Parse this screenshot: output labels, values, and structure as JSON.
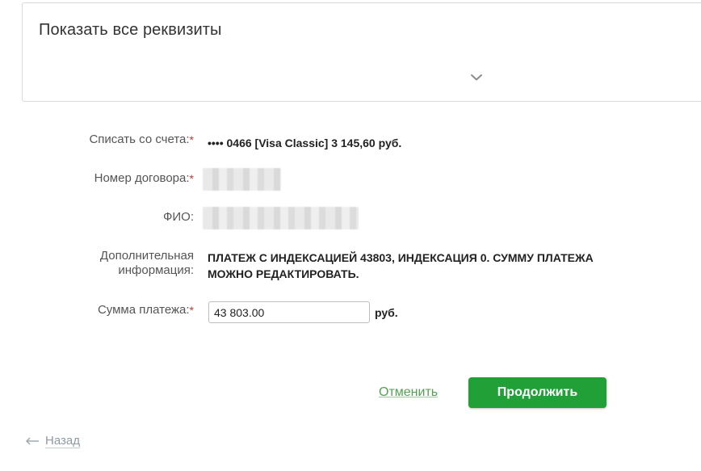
{
  "details": {
    "title": "Показать все реквизиты",
    "toggle_icon": "chevron-down-icon"
  },
  "form": {
    "account": {
      "label": "Списать со счета:",
      "required_mark": "*",
      "value": "•••• 0466  [Visa Classic] 3 145,60   руб."
    },
    "contract": {
      "label": "Номер договора:",
      "required_mark": "*"
    },
    "fio": {
      "label": "ФИО:"
    },
    "additional_info": {
      "label_line1": "Дополнительная",
      "label_line2": "информация:",
      "value_line1": "ПЛАТЕЖ С ИНДЕКСАЦИЕЙ 43803, ИНДЕКСАЦИЯ 0. СУММУ ПЛАТЕЖА",
      "value_line2": "МОЖНО РЕДАКТИРОВАТЬ."
    },
    "amount": {
      "label": "Сумма платежа:",
      "required_mark": "*",
      "value": "43 803.00",
      "currency": "руб."
    }
  },
  "actions": {
    "cancel_label": "Отменить",
    "continue_label": "Продолжить"
  },
  "navigation": {
    "back_label": "Назад",
    "back_icon": "arrow-left-icon"
  },
  "colors": {
    "primary_button": "#21a038",
    "link": "#52a152",
    "required": "#c0392b"
  }
}
